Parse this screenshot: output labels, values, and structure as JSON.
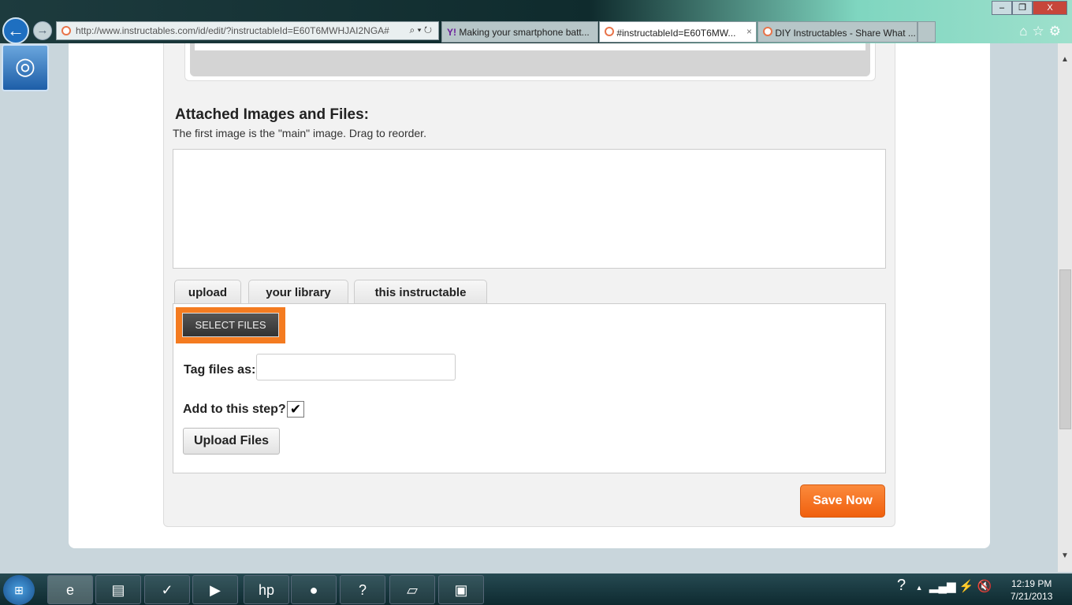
{
  "browser": {
    "address": "http://www.instructables.com/id/edit/?instructableId=E60T6MWHJAI2NGA#",
    "address_domain": "instructables.com",
    "tabs": [
      {
        "label": "Making your smartphone batt...",
        "active": false
      },
      {
        "label": "#instructableId=E60T6MW...",
        "active": true
      },
      {
        "label": "DIY Instructables - Share What ...",
        "active": false
      }
    ],
    "tab_close": "×",
    "window_buttons": [
      "–",
      "❐",
      "X"
    ],
    "tools_icons": [
      "home-icon",
      "star-icon",
      "gear-icon"
    ]
  },
  "page": {
    "heading": "Attached Images and Files:",
    "subtitle": "The first image is the \"main\" image. Drag to reorder.",
    "upload_tabs": [
      "upload",
      "your library",
      "this instructable"
    ],
    "select_files": "SELECT FILES",
    "tag_label": "Tag files as:",
    "tag_value": "",
    "add_label": "Add to this step?",
    "add_checked": true,
    "upload_button": "Upload Files",
    "save_button": "Save Now"
  },
  "colors": {
    "accent": "#f47b20",
    "save": "#f26a1b"
  },
  "taskbar": {
    "apps": [
      "ie-icon",
      "file-explorer-icon",
      "task-icon",
      "media-player-icon",
      "hp-icon",
      "orb-icon",
      "help-icon",
      "sticky-notes-icon",
      "photo-viewer-icon"
    ],
    "time": "12:19 PM",
    "date": "7/21/2013"
  }
}
